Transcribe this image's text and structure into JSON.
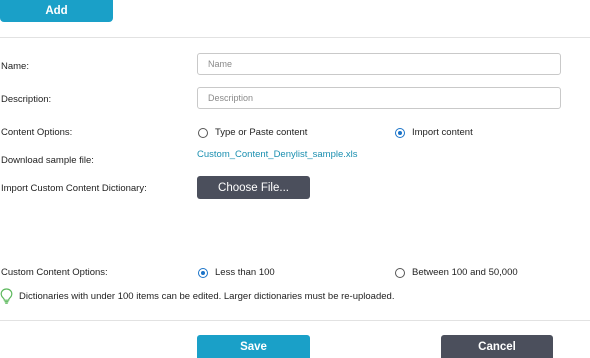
{
  "header": {
    "add_label": "Add"
  },
  "form": {
    "name": {
      "label": "Name:",
      "placeholder": "Name",
      "value": ""
    },
    "description": {
      "label": "Description:",
      "placeholder": "Description",
      "value": ""
    },
    "content_options": {
      "label": "Content Options:",
      "options": [
        {
          "label": "Type or Paste content",
          "selected": false
        },
        {
          "label": "Import content",
          "selected": true
        }
      ]
    },
    "sample_file": {
      "label": "Download sample file:",
      "link_text": "Custom_Content_Denylist_sample.xls"
    },
    "import_dictionary": {
      "label": "Import Custom Content Dictionary:",
      "button_label": "Choose File..."
    },
    "custom_content_options": {
      "label": "Custom Content Options:",
      "options": [
        {
          "label": "Less than 100",
          "selected": true
        },
        {
          "label": "Between 100 and 50,000",
          "selected": false
        }
      ]
    },
    "hint": {
      "icon": "lightbulb-icon",
      "text": "Dictionaries with under 100 items can be edited. Larger dictionaries must be re-uploaded."
    }
  },
  "footer": {
    "save_label": "Save",
    "cancel_label": "Cancel"
  },
  "colors": {
    "accent": "#1aa0c8",
    "dark_button": "#4b4f5c",
    "link": "#1a8fb0",
    "radio_selected": "#1a73c8",
    "hint_icon": "#5cb85c"
  }
}
